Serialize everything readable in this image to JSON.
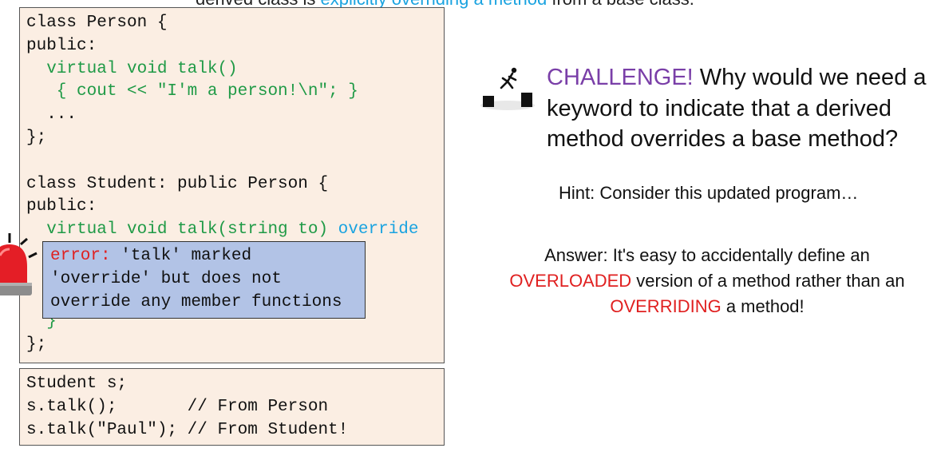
{
  "top_caption": {
    "part1": "derived class is ",
    "accent": "explicitly overriding a method",
    "part2": " from a base class."
  },
  "code_main": [
    [
      {
        "t": "class Person {",
        "c": ""
      }
    ],
    [
      {
        "t": "public:",
        "c": ""
      }
    ],
    [
      {
        "t": "  virtual void talk()",
        "c": "g"
      }
    ],
    [
      {
        "t": "   { cout << \"I'm a person!\\n\"; }",
        "c": "g"
      }
    ],
    [
      {
        "t": "  ...",
        "c": ""
      }
    ],
    [
      {
        "t": "};",
        "c": ""
      }
    ],
    [
      {
        "t": "",
        "c": ""
      }
    ],
    [
      {
        "t": "class Student: public Person {",
        "c": ""
      }
    ],
    [
      {
        "t": "public:",
        "c": ""
      }
    ],
    [
      {
        "t": "  virtual void talk(string to) ",
        "c": "g"
      },
      {
        "t": "override",
        "c": "b"
      }
    ],
    [
      {
        "t": "",
        "c": ""
      }
    ],
    [
      {
        "t": "",
        "c": ""
      }
    ],
    [
      {
        "t": "",
        "c": ""
      }
    ],
    [
      {
        "t": "  }",
        "c": "g"
      }
    ],
    [
      {
        "t": "};",
        "c": ""
      }
    ]
  ],
  "code_usage": [
    [
      {
        "t": "Student s;",
        "c": ""
      }
    ],
    [
      {
        "t": "s.talk();       // From Person",
        "c": ""
      }
    ],
    [
      {
        "t": "s.talk(\"Paul\"); // From Student!",
        "c": ""
      }
    ]
  ],
  "error": {
    "label": "error:",
    "line1": " 'talk' marked",
    "line2": "'override' but does not",
    "line3": "override any member functions"
  },
  "challenge": {
    "label": "CHALLENGE!",
    "text": " Why would we need a keyword to indicate that a derived method overrides a base method?"
  },
  "hint": "Hint: Consider this updated program…",
  "answer": {
    "part1": "Answer: It's easy to accidentally define an ",
    "overloaded": "OVERLOADED",
    "part2": " version of a method rather than an ",
    "overriding": "OVERRIDING",
    "part3": " a method!"
  },
  "icons": {
    "siren": "siren-alarm-icon",
    "challenge": "jumping-figure-icon"
  },
  "colors": {
    "code_keyword_green": "#1f9a46",
    "override_blue": "#1aa3e0",
    "error_red": "#e02020",
    "challenge_purple": "#7a3fa8",
    "error_box_bg": "#b2c3e6",
    "code_box_bg": "#fbeee3"
  }
}
